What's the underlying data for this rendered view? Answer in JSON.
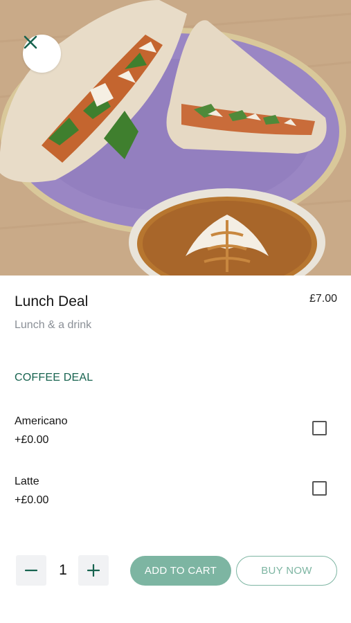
{
  "product": {
    "title": "Lunch Deal",
    "price": "£7.00",
    "subtitle": "Lunch & a drink",
    "image_icon": "product-photo"
  },
  "options": {
    "heading": "COFFEE DEAL",
    "items": [
      {
        "name": "Americano",
        "price": "+£0.00",
        "checked": false
      },
      {
        "name": "Latte",
        "price": "+£0.00",
        "checked": false
      }
    ]
  },
  "cart": {
    "quantity": "1",
    "add_to_cart_label": "ADD TO CART",
    "buy_now_label": "BUY NOW",
    "decrement_icon": "minus-icon",
    "increment_icon": "plus-icon"
  },
  "icons": {
    "close": "close-icon"
  },
  "colors": {
    "accent": "#17634f",
    "button_fill": "#7db5a2",
    "muted_text": "#8a8f96"
  }
}
